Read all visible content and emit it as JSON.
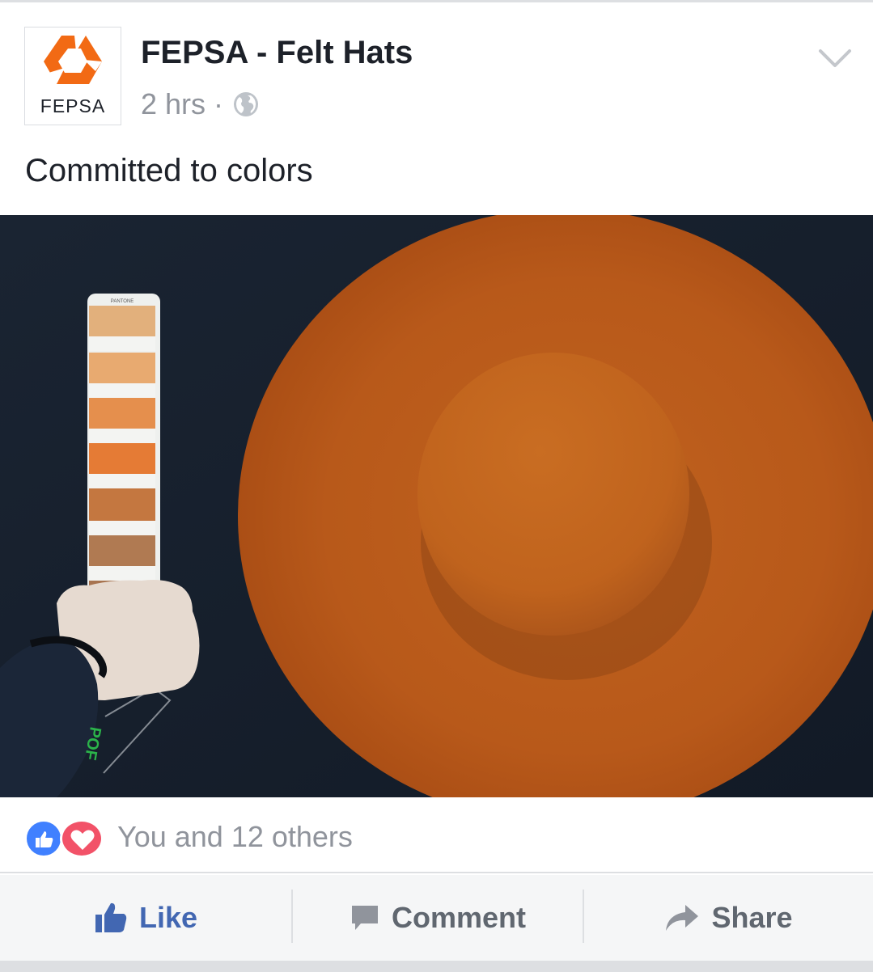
{
  "post": {
    "page_name": "FEPSA - Felt Hats",
    "avatar_text": "FEPSA",
    "time": "2 hrs",
    "separator": "·",
    "privacy_icon": "globe-icon",
    "menu_icon": "chevron-down-icon",
    "text": "Committed to colors",
    "photo_texts": {
      "swatch_brand": "PANTONE",
      "bottom_mark": "POF"
    }
  },
  "reactions": {
    "icons": [
      "like-reaction-icon",
      "love-reaction-icon"
    ],
    "summary": "You and 12 others"
  },
  "actions": {
    "like": "Like",
    "comment": "Comment",
    "share": "Share"
  },
  "colors": {
    "brand_orange": "#f26a14",
    "like_blue": "#4267b2",
    "love_red": "#f25268",
    "meta_gray": "#90949c",
    "text_dark": "#1d2129"
  }
}
